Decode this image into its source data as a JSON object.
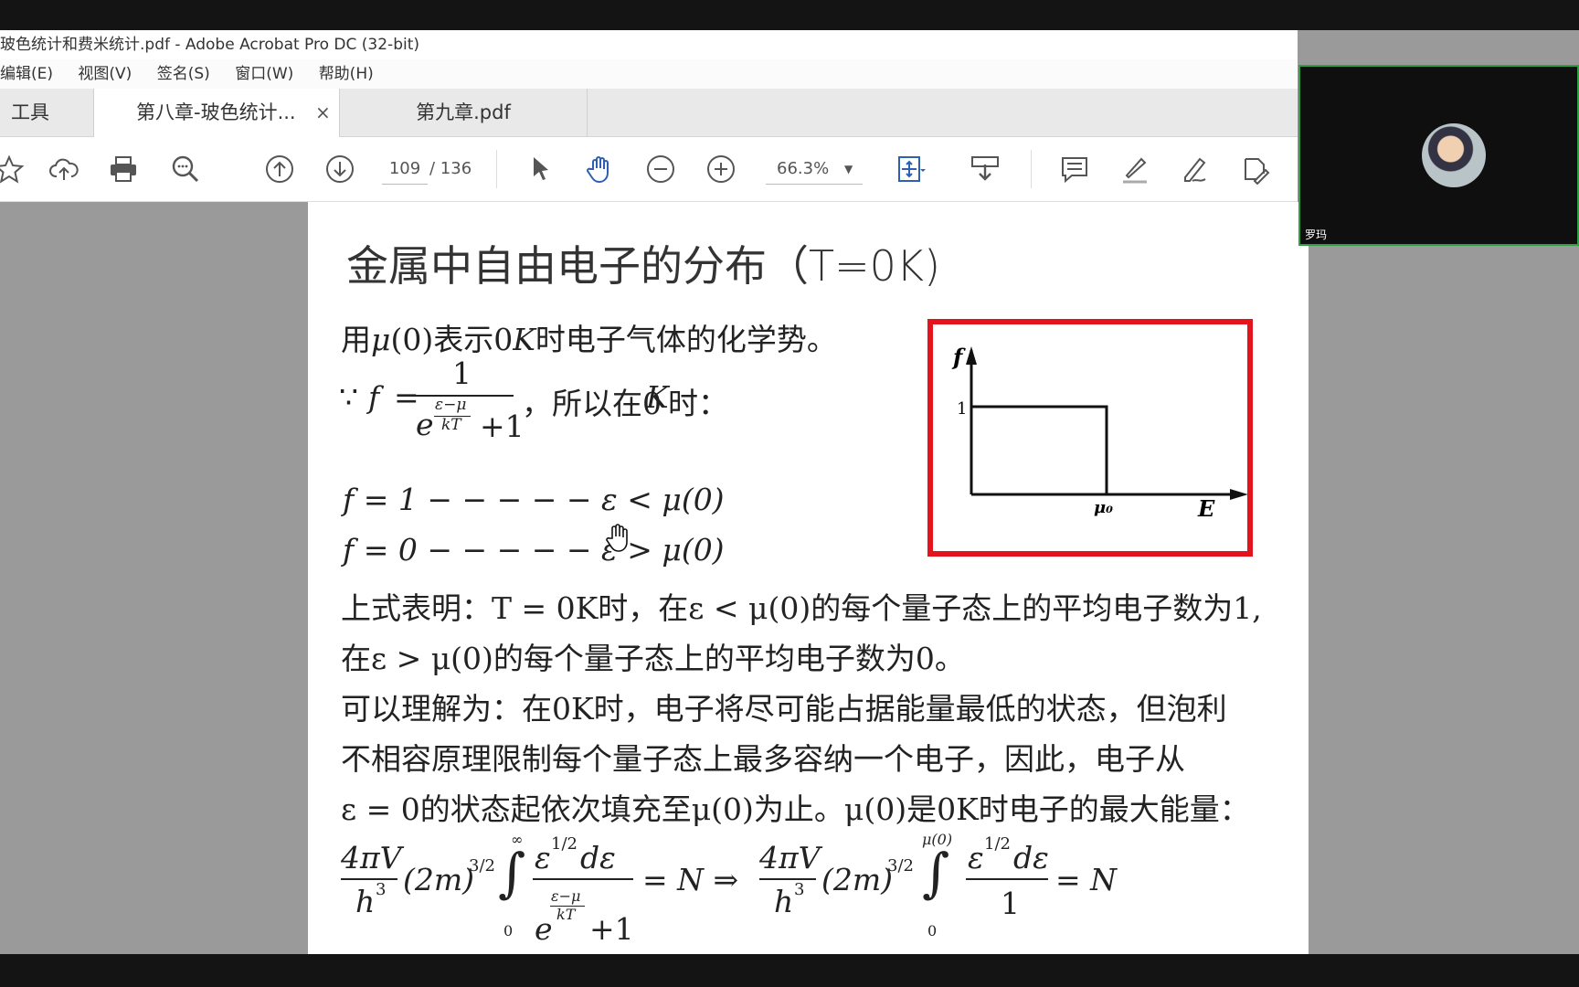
{
  "window": {
    "title": "玻色统计和费米统计.pdf - Adobe Acrobat Pro DC (32-bit)"
  },
  "menu": [
    "编辑(E)",
    "视图(V)",
    "签名(S)",
    "窗口(W)",
    "帮助(H)"
  ],
  "tabs": {
    "tools": "工具",
    "active": "第八章-玻色统计...",
    "close": "×",
    "other": "第九章.pdf"
  },
  "toolbar": {
    "page_current": "109",
    "page_total": "/ 136",
    "zoom": "66.3%",
    "zoom_caret": "▼"
  },
  "slide": {
    "title": "金属中自由电子的分布（T=0K)",
    "lines": {
      "l1a": "用",
      "l1b": "μ",
      "l1c": "(0)表示0",
      "l1d": "K",
      "l1e": "时电子气体的化学势。",
      "because": "∵",
      "f_eq": "f",
      "eq": "=",
      "num": "1",
      "exp_e": "e",
      "exp_num": "ε−μ",
      "exp_den": "kT",
      "plus1": "+1",
      "so": "，所以在0",
      "so_k": "K",
      "so_end": "时：",
      "l4": "f = 1 − − − − − ε < μ(0)",
      "l5": "f = 0 − − − − − ε > μ(0)",
      "l6": "上式表明：T = 0K时，在ε < μ(0)的每个量子态上的平均电子数为1,",
      "l7": "在ε > μ(0)的每个量子态上的平均电子数为0。",
      "l8": "可以理解为：在0K时，电子将尽可能占据能量最低的状态，但泡利",
      "l9": "不相容原理限制每个量子态上最多容纳一个电子，因此，电子从",
      "l10": "ε = 0的状态起依次填充至μ(0)为止。μ(0)是0K时电子的最大能量："
    },
    "formula": {
      "pre": "4πV",
      "h3": "h",
      "sup3": "3",
      "twom": "(2m)",
      "exp32": "3/2",
      "int_top": "∞",
      "int_bot": "0",
      "numer": "ε",
      "half": "1/2",
      "deps": "dε",
      "den_e": "e",
      "den_exp_num": "ε−μ",
      "den_exp_den": "kT",
      "den_plus": "+1",
      "eqN": "= N ⇒",
      "int2_top": "μ(0)",
      "int2_bot": "0",
      "den2": "1",
      "eqN2": "= N"
    },
    "graph": {
      "y_label": "f",
      "y_tick": "1",
      "x_label": "E",
      "x_tick": "μ₀"
    }
  },
  "webcam": {
    "name": "罗玛"
  },
  "colors": {
    "accent": "#2f5fb3",
    "frame": "#e3141b",
    "cam_border": "#2f9e44"
  }
}
